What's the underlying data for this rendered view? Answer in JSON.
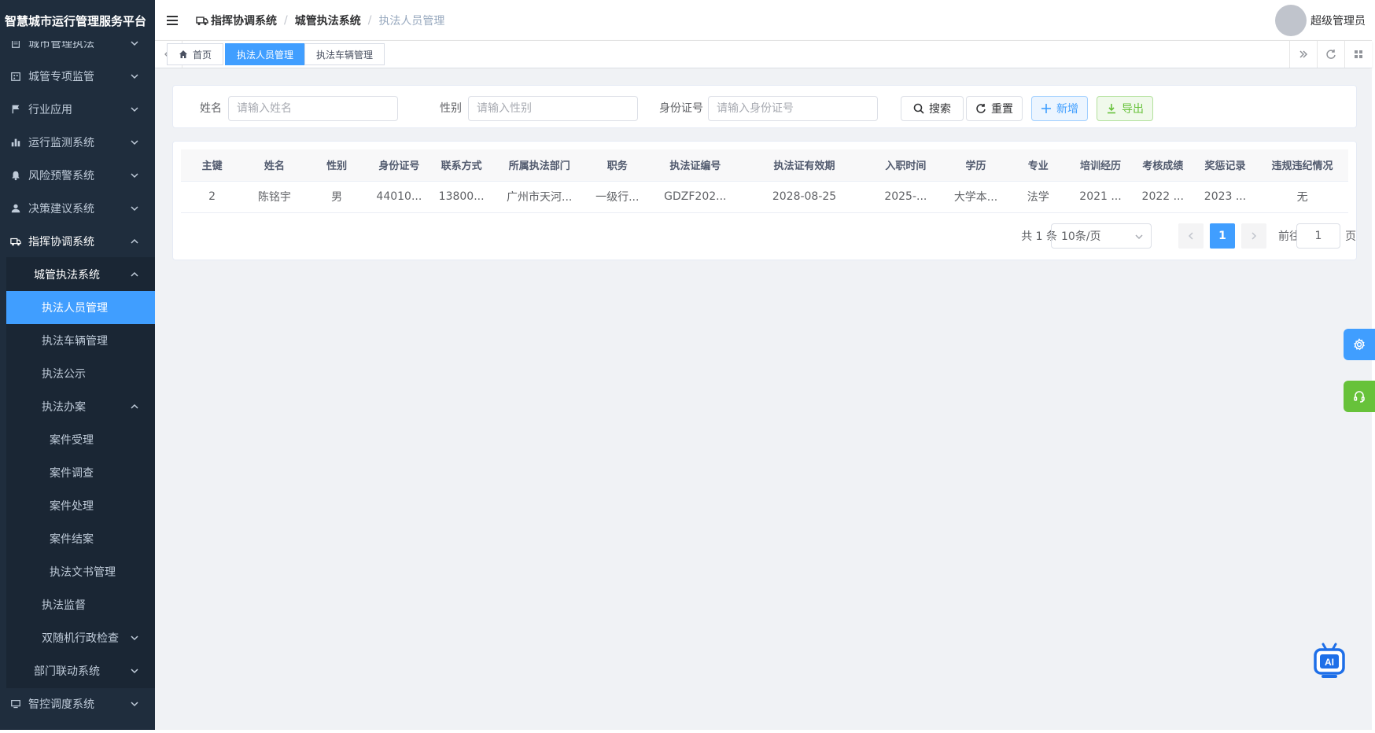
{
  "app": {
    "title": "智慧城市运行管理服务平台"
  },
  "sidebar": {
    "items": [
      {
        "label": "城市管理执法",
        "icon": "document-icon"
      },
      {
        "label": "城管专项监管",
        "icon": "building-icon"
      },
      {
        "label": "行业应用",
        "icon": "flag-icon"
      },
      {
        "label": "运行监测系统",
        "icon": "bar-chart-icon"
      },
      {
        "label": "风险预警系统",
        "icon": "bell-icon"
      },
      {
        "label": "决策建议系统",
        "icon": "user-icon"
      },
      {
        "label": "指挥协调系统",
        "icon": "truck-icon"
      },
      {
        "label": "城管执法系统"
      },
      {
        "label": "执法人员管理"
      },
      {
        "label": "执法车辆管理"
      },
      {
        "label": "执法公示"
      },
      {
        "label": "执法办案"
      },
      {
        "label": "案件受理"
      },
      {
        "label": "案件调查"
      },
      {
        "label": "案件处理"
      },
      {
        "label": "案件结案"
      },
      {
        "label": "执法文书管理"
      },
      {
        "label": "执法监督"
      },
      {
        "label": "双随机行政检查"
      },
      {
        "label": "部门联动系统"
      },
      {
        "label": "智控调度系统",
        "icon": "monitor-icon"
      }
    ]
  },
  "navbar": {
    "breadcrumb": [
      "指挥协调系统",
      "城管执法系统",
      "执法人员管理"
    ],
    "user_name": "超级管理员"
  },
  "tags": [
    "首页",
    "执法人员管理",
    "执法车辆管理"
  ],
  "search": {
    "name_label": "姓名",
    "name_placeholder": "请输入姓名",
    "gender_label": "性别",
    "gender_placeholder": "请输入性别",
    "id_label": "身份证号",
    "id_placeholder": "请输入身份证号",
    "search_btn": "搜索",
    "reset_btn": "重置",
    "add_btn": "新增",
    "export_btn": "导出"
  },
  "table": {
    "columns": [
      "主键",
      "姓名",
      "性别",
      "身份证号",
      "联系方式",
      "所属执法部门",
      "职务",
      "执法证编号",
      "执法证有效期",
      "入职时间",
      "学历",
      "专业",
      "培训经历",
      "考核成绩",
      "奖惩记录",
      "违规违纪情况"
    ],
    "rows": [
      [
        "2",
        "陈铭宇",
        "男",
        "44010...",
        "13800...",
        "广州市天河...",
        "一级行...",
        "GDZF202...",
        "2028-08-25",
        "2025-...",
        "大学本...",
        "法学",
        "2021 ...",
        "2022 ...",
        "2023 ...",
        "无"
      ]
    ]
  },
  "pagination": {
    "total": "共 1 条",
    "page_size": "10条/页",
    "current": "1",
    "goto_label": "前往",
    "goto_value": "1",
    "page_label": "页"
  },
  "colors": {
    "primary": "#409eff",
    "success": "#67c23a",
    "sidebar_bg": "#1f2d3d"
  }
}
